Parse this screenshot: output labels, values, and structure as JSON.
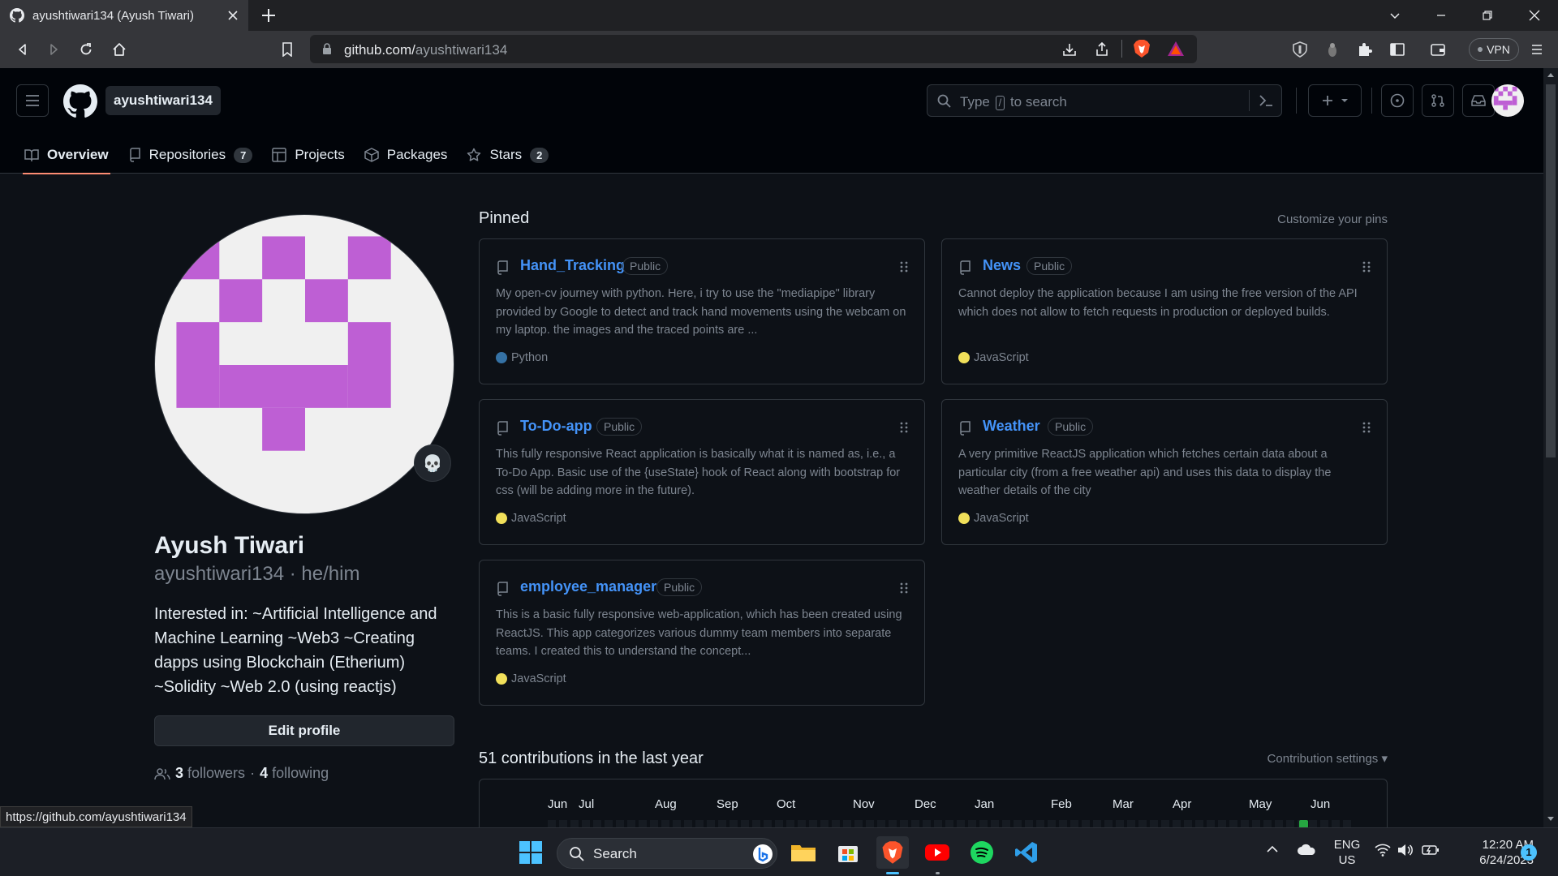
{
  "browser": {
    "tab_title": "ayushtiwari134 (Ayush Tiwari)",
    "url_host": "github.com/",
    "url_path": "ayushtiwari134",
    "vpn_label": "VPN",
    "status_url": "https://github.com/ayushtiwari134"
  },
  "header": {
    "username_crumb": "ayushtiwari134",
    "search_pre": "Type",
    "search_key": "/",
    "search_post": "to search",
    "plus_label": "+"
  },
  "tabs": [
    {
      "label": "Overview",
      "icon": "book-icon"
    },
    {
      "label": "Repositories",
      "count": "7",
      "icon": "repo-icon"
    },
    {
      "label": "Projects",
      "icon": "table-icon"
    },
    {
      "label": "Packages",
      "icon": "package-icon"
    },
    {
      "label": "Stars",
      "count": "2",
      "icon": "star-icon"
    }
  ],
  "profile": {
    "full_name": "Ayush Tiwari",
    "login_line": "ayushtiwari134 · he/him",
    "bio": "Interested in: ~Artificial Intelligence and Machine Learning ~Web3 ~Creating dapps using Blockchain (Etherium) ~Solidity ~Web 2.0 (using reactjs)",
    "edit_label": "Edit profile",
    "followers_count": "3",
    "followers_label": "followers",
    "sep": "·",
    "following_count": "4",
    "following_label": "following",
    "avatar_color": "#be5fd4"
  },
  "pinned": {
    "title": "Pinned",
    "customize": "Customize your pins",
    "repos": [
      {
        "name": "Hand_Tracking",
        "visibility": "Public",
        "desc": "My open-cv journey with python. Here, i try to use the \"mediapipe\" library provided by Google to detect and track hand movements using the webcam on my laptop. the images and the traced points are ...",
        "lang": "Python",
        "lang_color": "#3572A5"
      },
      {
        "name": "News",
        "visibility": "Public",
        "desc": "Cannot deploy the application because I am using the free version of the API which does not allow to fetch requests in production or deployed builds.",
        "lang": "JavaScript",
        "lang_color": "#f1e05a"
      },
      {
        "name": "To-Do-app",
        "visibility": "Public",
        "desc": "This fully responsive React application is basically what it is named as, i.e., a To-Do App. Basic use of the {useState} hook of React along with bootstrap for css (will be adding more in the future).",
        "lang": "JavaScript",
        "lang_color": "#f1e05a"
      },
      {
        "name": "Weather",
        "visibility": "Public",
        "desc": "A very primitive ReactJS application which fetches certain data about a particular city (from a free weather api) and uses this data to display the weather details of the city",
        "lang": "JavaScript",
        "lang_color": "#f1e05a"
      },
      {
        "name": "employee_manager",
        "visibility": "Public",
        "desc": "This is a basic fully responsive web-application, which has been created using ReactJS. This app categorizes various dummy team members into separate teams. I created this to understand the concept...",
        "lang": "JavaScript",
        "lang_color": "#f1e05a"
      }
    ]
  },
  "contributions": {
    "title": "51 contributions in the last year",
    "settings": "Contribution settings",
    "months": [
      "Jun",
      "Jul",
      "Aug",
      "Sep",
      "Oct",
      "Nov",
      "Dec",
      "Jan",
      "Feb",
      "Mar",
      "Apr",
      "May",
      "Jun"
    ]
  },
  "taskbar": {
    "search_label": "Search",
    "lang_line1": "ENG",
    "lang_line2": "US",
    "time": "12:20 AM",
    "date": "6/24/2023",
    "notif_count": "1"
  }
}
